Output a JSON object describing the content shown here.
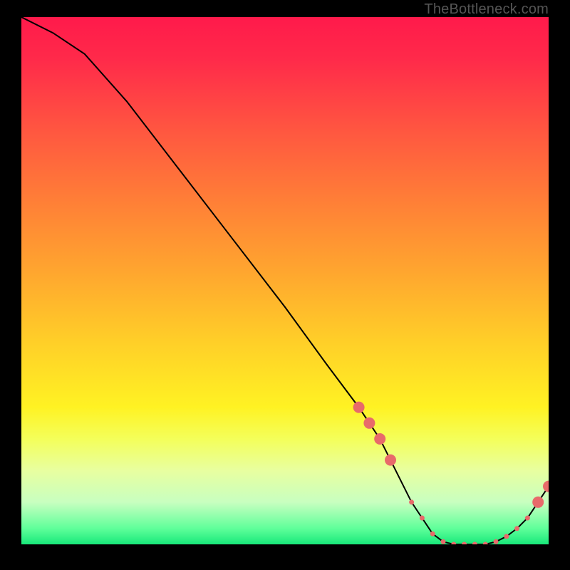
{
  "attribution": "TheBottleneck.com",
  "chart_data": {
    "type": "line",
    "title": "",
    "xlabel": "",
    "ylabel": "",
    "xlim": [
      0,
      100
    ],
    "ylim": [
      0,
      100
    ],
    "x": [
      0,
      6,
      12,
      20,
      30,
      40,
      50,
      58,
      64,
      68,
      70,
      72,
      74,
      76,
      78,
      80,
      82,
      84,
      86,
      88,
      90,
      92,
      94,
      96,
      98,
      100
    ],
    "values": [
      100,
      97,
      93,
      84,
      71,
      58,
      45,
      34,
      26,
      20,
      16,
      12,
      8,
      5,
      2,
      0.5,
      0,
      0,
      0,
      0,
      0.5,
      1.5,
      3,
      5,
      8,
      11
    ],
    "markers": {
      "x": [
        64,
        66,
        68,
        70,
        74,
        76,
        78,
        80,
        82,
        84,
        86,
        88,
        90,
        92,
        94,
        96,
        98,
        100
      ],
      "values": [
        26,
        23,
        20,
        16,
        8,
        5,
        2,
        0.5,
        0,
        0,
        0,
        0,
        0.5,
        1.5,
        3,
        5,
        8,
        11
      ],
      "big_idx": [
        0,
        1,
        2,
        3,
        16,
        17
      ],
      "small_idx": [
        4,
        5,
        6,
        7,
        8,
        9,
        10,
        11,
        12,
        13,
        14,
        15
      ]
    },
    "colors": {
      "line": "#000000",
      "marker": "#e86a6a"
    }
  }
}
